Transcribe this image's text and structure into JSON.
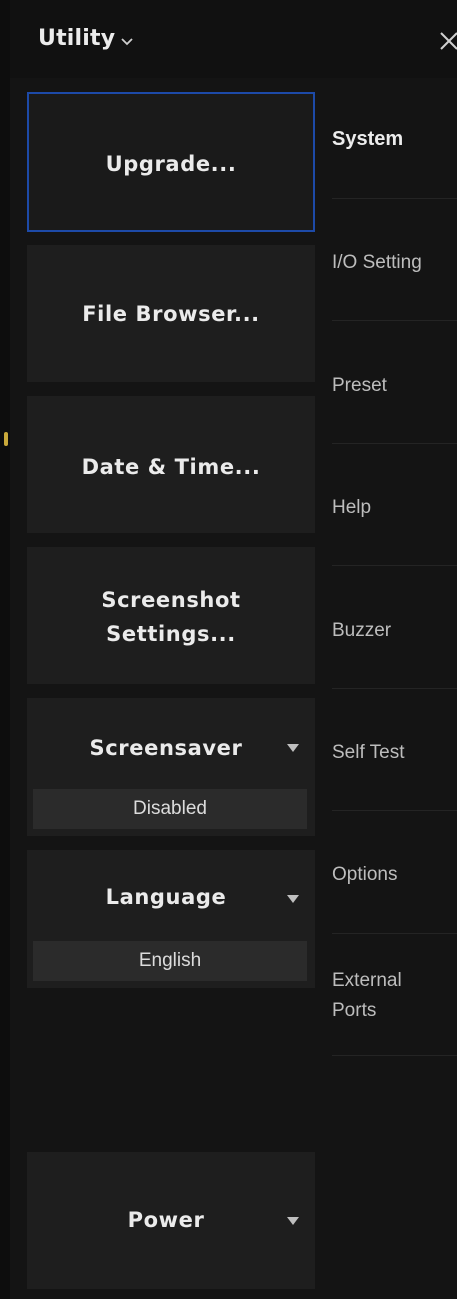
{
  "header": {
    "title": "Utility",
    "close_icon": "close-icon",
    "chevron_icon": "chevron-down-icon"
  },
  "tiles": {
    "upgrade": "Upgrade...",
    "file_browser": "File Browser...",
    "date_time": "Date & Time...",
    "screenshot_line1": "Screenshot",
    "screenshot_line2": "Settings...",
    "screensaver": {
      "label": "Screensaver",
      "value": "Disabled"
    },
    "language": {
      "label": "Language",
      "value": "English"
    },
    "power": "Power"
  },
  "categories": [
    {
      "label": "System",
      "active": true
    },
    {
      "label": "I/O Setting"
    },
    {
      "label": "Preset"
    },
    {
      "label": "Help"
    },
    {
      "label": "Buzzer"
    },
    {
      "label": "Self Test"
    },
    {
      "label": "Options"
    },
    {
      "label": "External Ports",
      "line1": "External",
      "line2": "Ports"
    }
  ],
  "colors": {
    "background": "#141414",
    "tile": "#1e1e1e",
    "selected_border": "#1d4aa8",
    "value_box": "#2b2b2b"
  }
}
